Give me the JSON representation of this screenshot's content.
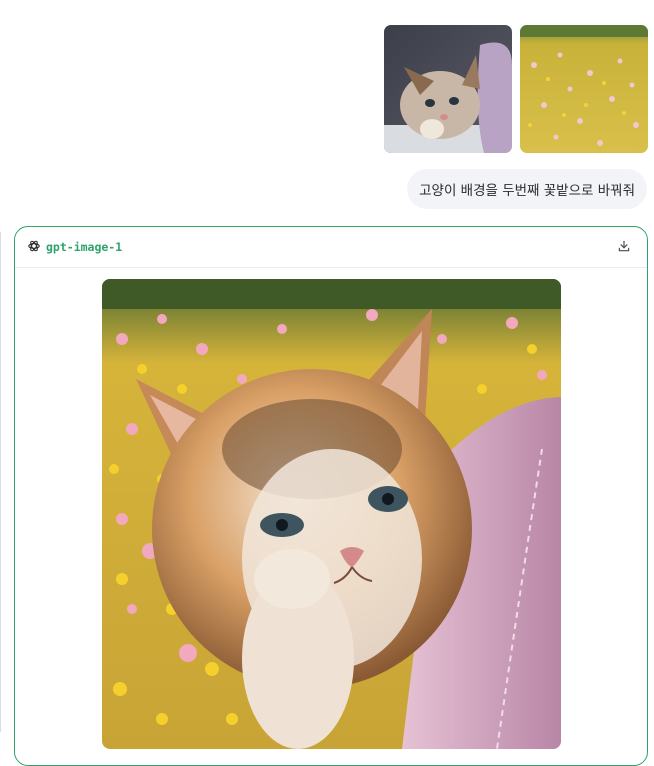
{
  "user_message": {
    "text": "고양이 배경을 두번째 꽃밭으로 바꿔줘",
    "attachments": [
      {
        "icon": "cat-photo-thumbnail"
      },
      {
        "icon": "flower-field-photo-thumbnail"
      }
    ]
  },
  "result": {
    "model_label": "gpt-image-1",
    "model_icon": "openai-logo-icon",
    "download_icon": "download-icon",
    "image_icon": "generated-cat-in-flower-field-image"
  },
  "colors": {
    "accent": "#2fa36b",
    "bubble_bg": "#f3f4f8"
  }
}
